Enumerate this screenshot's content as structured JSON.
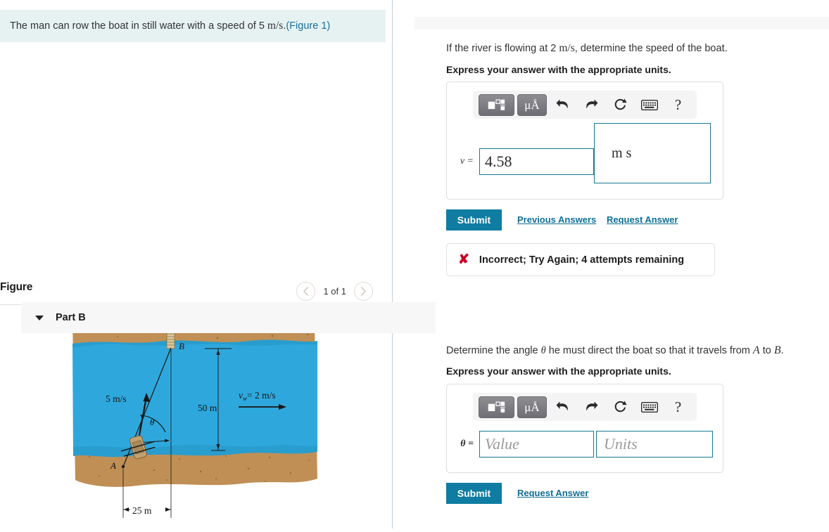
{
  "problem": {
    "text_before": "The man can row the boat in still water with a speed of 5 ",
    "unit": "m/s",
    "text_after": ".",
    "figure_link": "(Figure 1)"
  },
  "figure_panel": {
    "title": "Figure",
    "counter": "1 of 1",
    "prev_icon": "chevron-left-icon",
    "next_icon": "chevron-right-icon",
    "diagram": {
      "speed_label": "5 m/s",
      "water_speed_label_sym": "v",
      "water_speed_label_sub": "w",
      "water_speed_label_rest": "= 2 m/s",
      "width_label": "50 m",
      "offset_label": "25 m",
      "point_a": "A",
      "point_b": "B",
      "angle_symbol": "θ",
      "colors": {
        "water": "#2ea8dc",
        "sand": "#c08f55",
        "sand_dark": "#a87a43",
        "water_shadow": "#2596c4",
        "boat": "#c0a173",
        "line": "#1a1a1a"
      }
    }
  },
  "part_a": {
    "question_before": "If the river is flowing at 2 ",
    "question_unit": "m/s",
    "question_after": ", determine the speed of the boat.",
    "instruction": "Express your answer with the appropriate units.",
    "toolbar": {
      "template_icon": "math-template-icon",
      "units_icon_label": "μÅ",
      "undo_icon": "undo-arrow-icon",
      "redo_icon": "redo-arrow-icon",
      "reset_icon": "reset-circle-icon",
      "keyboard_icon": "keyboard-icon",
      "help_icon": "?"
    },
    "variable": "v =",
    "value": "4.58",
    "units_numerator": "m",
    "units_denominator": "s",
    "submit_label": "Submit",
    "previous_answers_label": "Previous Answers",
    "request_answer_label": "Request Answer",
    "feedback": {
      "icon": "x-mark-icon",
      "message": "Incorrect; Try Again; 4 attempts remaining"
    }
  },
  "part_b": {
    "header_label": "Part B",
    "caret_icon": "caret-down-icon",
    "question_before": "Determine the angle ",
    "question_theta": "θ",
    "question_mid": " he must direct the boat so that it travels from ",
    "question_a": "A",
    "question_to": " to ",
    "question_b": "B",
    "question_end": ".",
    "instruction": "Express your answer with the appropriate units.",
    "toolbar": {
      "template_icon": "math-template-icon",
      "units_icon_label": "μÅ",
      "undo_icon": "undo-arrow-icon",
      "redo_icon": "redo-arrow-icon",
      "reset_icon": "reset-circle-icon",
      "keyboard_icon": "keyboard-icon",
      "help_icon": "?"
    },
    "variable": "θ =",
    "value_placeholder": "Value",
    "units_placeholder": "Units",
    "submit_label": "Submit",
    "request_answer_label": "Request Answer"
  }
}
